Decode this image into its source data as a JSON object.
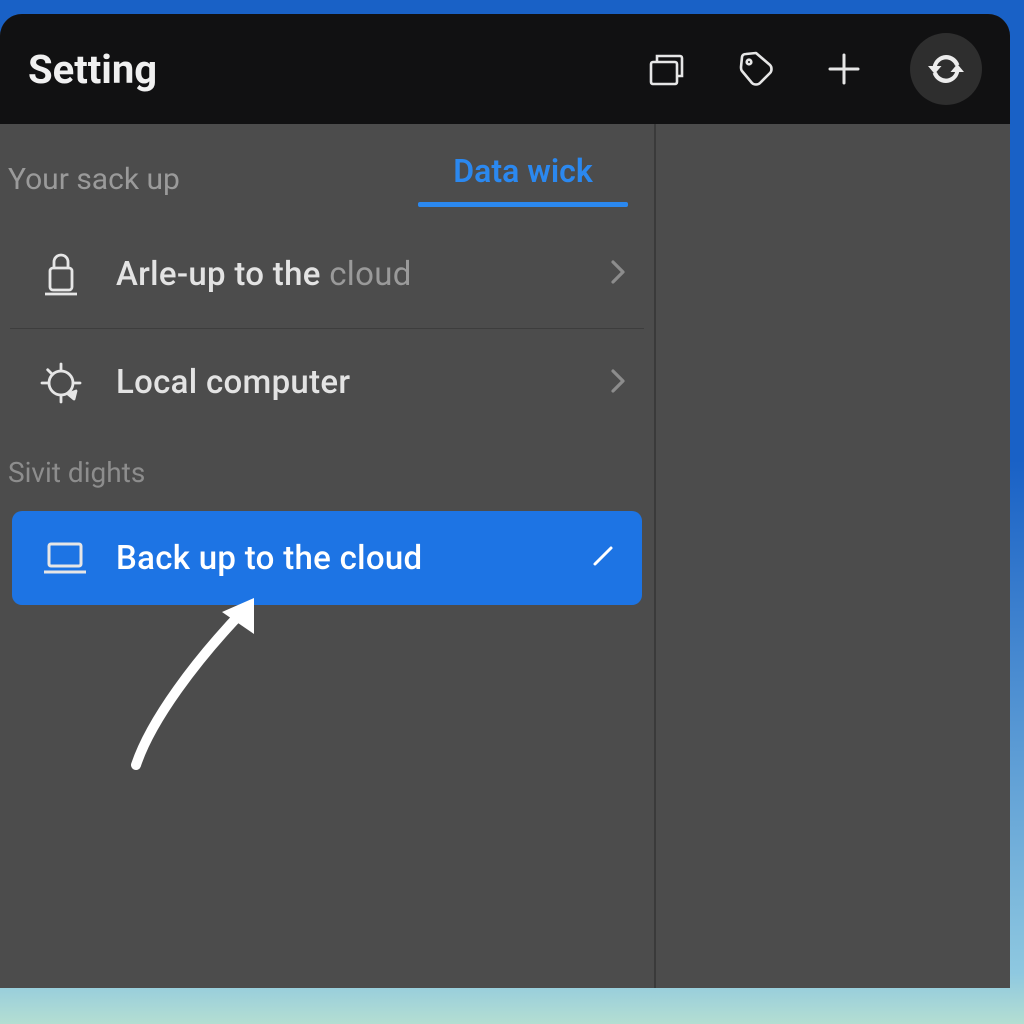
{
  "header": {
    "title": "Setting"
  },
  "tabs": {
    "active": "Data wick"
  },
  "sections": {
    "group1_label": "Your sack up",
    "group2_label": "Sivit dights"
  },
  "items": {
    "cloud_backup": {
      "label_main": "Arle-up to the",
      "label_dim": "cloud"
    },
    "local_computer": {
      "label": "Local computer"
    },
    "backup_cloud_primary": {
      "label": "Back up to the cloud"
    }
  },
  "icons": {
    "collections": "collections-icon",
    "tag": "tag-icon",
    "add": "plus-icon",
    "sync": "sync-icon",
    "lock": "lock-icon",
    "gear": "gear-icon",
    "laptop": "laptop-icon",
    "edit": "edit-icon",
    "chevron": "chevron-right-icon"
  },
  "colors": {
    "accent": "#1d74e4",
    "tab_active": "#2b88ef",
    "bg_window": "#4c4c4c",
    "bg_titlebar": "#111112"
  }
}
